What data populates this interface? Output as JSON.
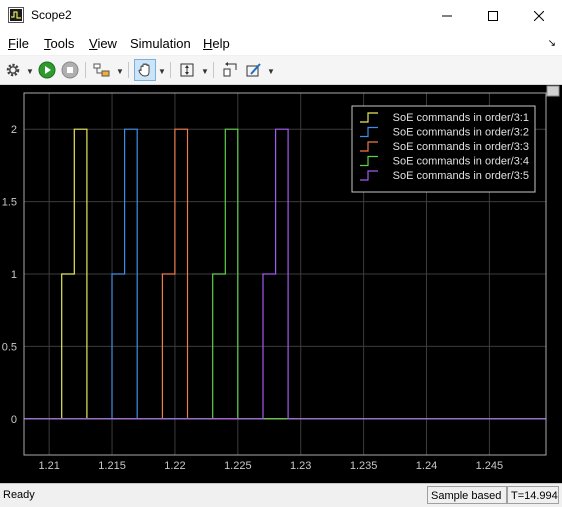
{
  "window": {
    "title": "Scope2",
    "minimize": "—",
    "maximize": "☐",
    "close": "✕"
  },
  "menu": {
    "items": [
      {
        "mnemonic": "F",
        "rest": "ile"
      },
      {
        "mnemonic": "T",
        "rest": "ools"
      },
      {
        "mnemonic": "V",
        "rest": "iew"
      },
      {
        "mnemonic": "S",
        "rest": "imulation",
        "prefix": ""
      },
      {
        "mnemonic": "H",
        "rest": "elp"
      }
    ],
    "dock_arrow": "↘"
  },
  "toolbar": {
    "icons": [
      "gear-icon",
      "run-icon",
      "stop-icon",
      "signal-select-icon",
      "pan-hand-icon",
      "autoscale-icon",
      "highlight-block-icon",
      "draw-icon"
    ]
  },
  "colors": {
    "background": "#000000",
    "axes": "#aaaaaa",
    "grid": "#3c3c3c",
    "series": [
      "#e5e85a",
      "#3d8fe8",
      "#ee7a4a",
      "#5fd04b",
      "#a259f0"
    ]
  },
  "chart_data": {
    "type": "line",
    "step": true,
    "xlim": [
      1.208,
      1.2495
    ],
    "ylim": [
      -0.25,
      2.25
    ],
    "xticks": [
      1.21,
      1.215,
      1.22,
      1.225,
      1.23,
      1.235,
      1.24,
      1.245
    ],
    "xtick_labels": [
      "1.21",
      "1.215",
      "1.22",
      "1.225",
      "1.23",
      "1.235",
      "1.24",
      "1.245"
    ],
    "yticks": [
      0,
      0.5,
      1,
      1.5,
      2
    ],
    "ytick_labels": [
      "0",
      "0.5",
      "1",
      "1.5",
      "2"
    ],
    "grid": true,
    "legend_position": "top-right",
    "series": [
      {
        "name": "SoE commands in order/3:1",
        "x": [
          1.208,
          1.211,
          1.211,
          1.212,
          1.212,
          1.213,
          1.213,
          1.2495
        ],
        "y": [
          0,
          0,
          1,
          1,
          2,
          2,
          0,
          0
        ]
      },
      {
        "name": "SoE commands in order/3:2",
        "x": [
          1.208,
          1.215,
          1.215,
          1.216,
          1.216,
          1.217,
          1.217,
          1.2495
        ],
        "y": [
          0,
          0,
          1,
          1,
          2,
          2,
          0,
          0
        ]
      },
      {
        "name": "SoE commands in order/3:3",
        "x": [
          1.208,
          1.219,
          1.219,
          1.22,
          1.22,
          1.221,
          1.221,
          1.2495
        ],
        "y": [
          0,
          0,
          1,
          1,
          2,
          2,
          0,
          0
        ]
      },
      {
        "name": "SoE commands in order/3:4",
        "x": [
          1.208,
          1.223,
          1.223,
          1.224,
          1.224,
          1.225,
          1.225,
          1.2495
        ],
        "y": [
          0,
          0,
          1,
          1,
          2,
          2,
          0,
          0
        ]
      },
      {
        "name": "SoE commands in order/3:5",
        "x": [
          1.208,
          1.227,
          1.227,
          1.228,
          1.228,
          1.229,
          1.229,
          1.2495
        ],
        "y": [
          0,
          0,
          1,
          1,
          2,
          2,
          0,
          0
        ]
      }
    ]
  },
  "status": {
    "ready": "Ready",
    "mode": "Sample based",
    "time": "T=14.994"
  }
}
